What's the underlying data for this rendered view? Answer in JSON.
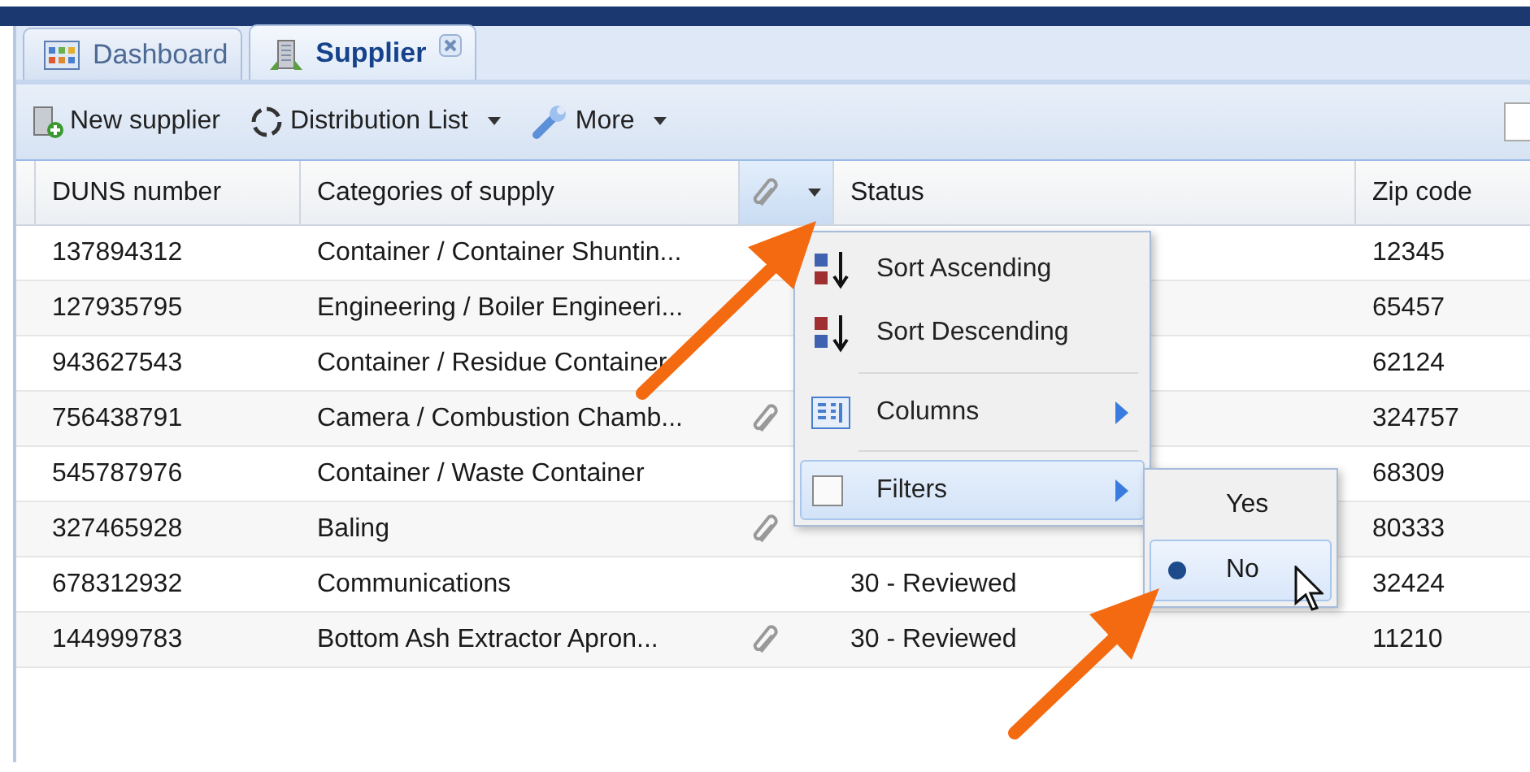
{
  "tabs": [
    {
      "label": "Dashboard",
      "selected": false,
      "closable": false
    },
    {
      "label": "Supplier",
      "selected": true,
      "closable": true
    }
  ],
  "toolbar": {
    "buttons": [
      {
        "label": "New supplier",
        "has_menu": false
      },
      {
        "label": "Distribution List",
        "has_menu": true
      },
      {
        "label": "More",
        "has_menu": true
      }
    ]
  },
  "table": {
    "columns": [
      {
        "label": "DUNS number",
        "kind": "text"
      },
      {
        "label": "Categories of supply",
        "kind": "text"
      },
      {
        "kind": "attachment",
        "menu_open": true
      },
      {
        "label": "Status",
        "kind": "text"
      },
      {
        "label": "Zip code",
        "kind": "text"
      }
    ],
    "rows": [
      {
        "duns": "137894312",
        "category": "Container / Container Shuntin...",
        "attachment": false,
        "zip": "12345"
      },
      {
        "duns": "127935795",
        "category": "Engineering / Boiler Engineeri...",
        "attachment": false,
        "zip": "65457"
      },
      {
        "duns": "943627543",
        "category": "Container / Residue Container",
        "attachment": false,
        "zip": "62124"
      },
      {
        "duns": "756438791",
        "category": "Camera / Combustion Chamb...",
        "attachment": true,
        "zip": "324757"
      },
      {
        "duns": "545787976",
        "category": "Container / Waste Container",
        "attachment": false,
        "zip": "68309"
      },
      {
        "duns": "327465928",
        "category": "Baling",
        "attachment": true,
        "zip": "80333"
      },
      {
        "duns": "678312932",
        "category": "Communications",
        "attachment": false,
        "status": "30 - Reviewed",
        "zip": "32424"
      },
      {
        "duns": "144999783",
        "category": "Bottom Ash Extractor Apron...",
        "attachment": true,
        "status": "30 - Reviewed",
        "zip": "11210"
      }
    ]
  },
  "column_menu": {
    "items": [
      {
        "kind": "sort_asc",
        "label": "Sort Ascending"
      },
      {
        "kind": "sort_desc",
        "label": "Sort Descending"
      },
      {
        "kind": "separator"
      },
      {
        "kind": "columns",
        "label": "Columns"
      },
      {
        "kind": "separator"
      },
      {
        "kind": "filters",
        "label": "Filters",
        "checked": false,
        "selected": true,
        "submenu": [
          {
            "label": "Yes",
            "checked": false,
            "selected": false
          },
          {
            "label": "No",
            "checked": true,
            "selected": true
          }
        ]
      }
    ]
  }
}
